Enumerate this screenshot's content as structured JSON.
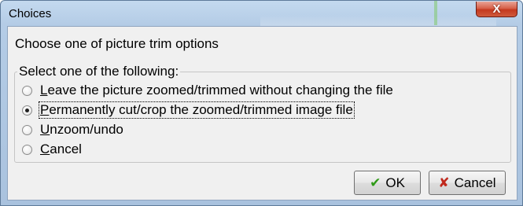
{
  "window": {
    "title": "Choices",
    "close_symbol": "X"
  },
  "dialog": {
    "heading": "Choose one of picture trim options",
    "group_label": "Select one of the following:",
    "options": [
      {
        "pre": "",
        "key": "L",
        "post": "eave the picture zoomed/trimmed without changing the file",
        "checked": false
      },
      {
        "pre": "",
        "key": "P",
        "post": "ermanently cut/crop the zoomed/trimmed image file",
        "checked": true
      },
      {
        "pre": "",
        "key": "U",
        "post": "nzoom/undo",
        "checked": false
      },
      {
        "pre": "",
        "key": "C",
        "post": "ancel",
        "checked": false
      }
    ],
    "ok_label": "OK",
    "cancel_label": "Cancel",
    "ok_icon": "check-icon",
    "cancel_icon": "x-icon",
    "accent_ok": "#2f9a18",
    "accent_cancel": "#c0281c"
  }
}
